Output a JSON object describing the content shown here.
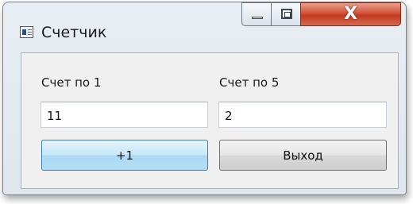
{
  "window": {
    "title": "Счетчик",
    "icon": "app-window-icon",
    "controls": {
      "minimize_icon": "minimize-icon",
      "maximize_icon": "maximize-icon",
      "close_glyph": "X"
    }
  },
  "form": {
    "label_count1": "Счет по 1",
    "label_count5": "Счет по 5",
    "value_count1": "11",
    "value_count5": "2",
    "button_plus_label": "+1",
    "button_exit_label": "Выход"
  },
  "colors": {
    "close_button": "#c13a21",
    "primary_button": "#aad9f3",
    "client_background": "#f0f0f0"
  }
}
